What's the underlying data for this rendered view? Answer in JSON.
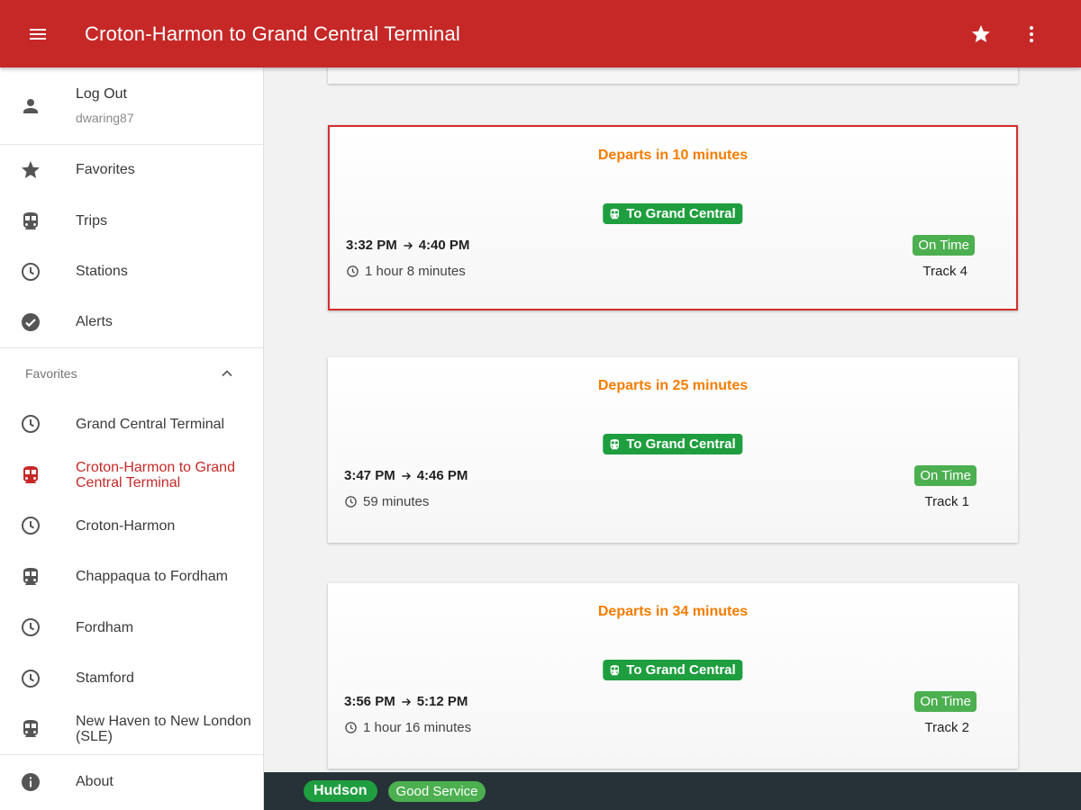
{
  "appbar": {
    "title": "Croton-Harmon to Grand Central Terminal",
    "brand_color": "#c62828"
  },
  "drawer": {
    "account": {
      "name": "Log Out",
      "username": "dwaring87"
    },
    "nav": [
      {
        "icon": "star-icon",
        "label": "Favorites"
      },
      {
        "icon": "train-icon",
        "label": "Trips"
      },
      {
        "icon": "clock-icon",
        "label": "Stations"
      },
      {
        "icon": "check-circle-icon",
        "label": "Alerts"
      }
    ],
    "favorites_header": "Favorites",
    "favorites": [
      {
        "icon": "clock-icon",
        "label": "Grand Central Terminal",
        "active": false
      },
      {
        "icon": "train-icon",
        "label": "Croton-Harmon to Grand Central Terminal",
        "active": true
      },
      {
        "icon": "clock-icon",
        "label": "Croton-Harmon",
        "active": false
      },
      {
        "icon": "train-icon",
        "label": "Chappaqua to Fordham",
        "active": false
      },
      {
        "icon": "clock-icon",
        "label": "Fordham",
        "active": false
      },
      {
        "icon": "clock-icon",
        "label": "Stamford",
        "active": false
      },
      {
        "icon": "train-icon",
        "label": "New Haven to New London (SLE)",
        "active": false
      }
    ],
    "about": "About"
  },
  "trips": [
    {
      "departs": "Departs in 10 minutes",
      "destination": "To Grand Central",
      "depart_time": "3:32 PM",
      "arrive_time": "4:40 PM",
      "duration": "1 hour 8 minutes",
      "status": "On Time",
      "track": "Track 4",
      "selected": true
    },
    {
      "departs": "Departs in 25 minutes",
      "destination": "To Grand Central",
      "depart_time": "3:47 PM",
      "arrive_time": "4:46 PM",
      "duration": "59 minutes",
      "status": "On Time",
      "track": "Track 1",
      "selected": false
    },
    {
      "departs": "Departs in 34 minutes",
      "destination": "To Grand Central",
      "depart_time": "3:56 PM",
      "arrive_time": "5:12 PM",
      "duration": "1 hour 16 minutes",
      "status": "On Time",
      "track": "Track 2",
      "selected": false
    }
  ],
  "service": {
    "line": "Hudson",
    "status": "Good Service"
  },
  "colors": {
    "accent": "#c62828",
    "departs": "#f57c00",
    "line_green": "#1e9e3e",
    "status_green": "#4caf50",
    "bottom_bar": "#263238"
  }
}
